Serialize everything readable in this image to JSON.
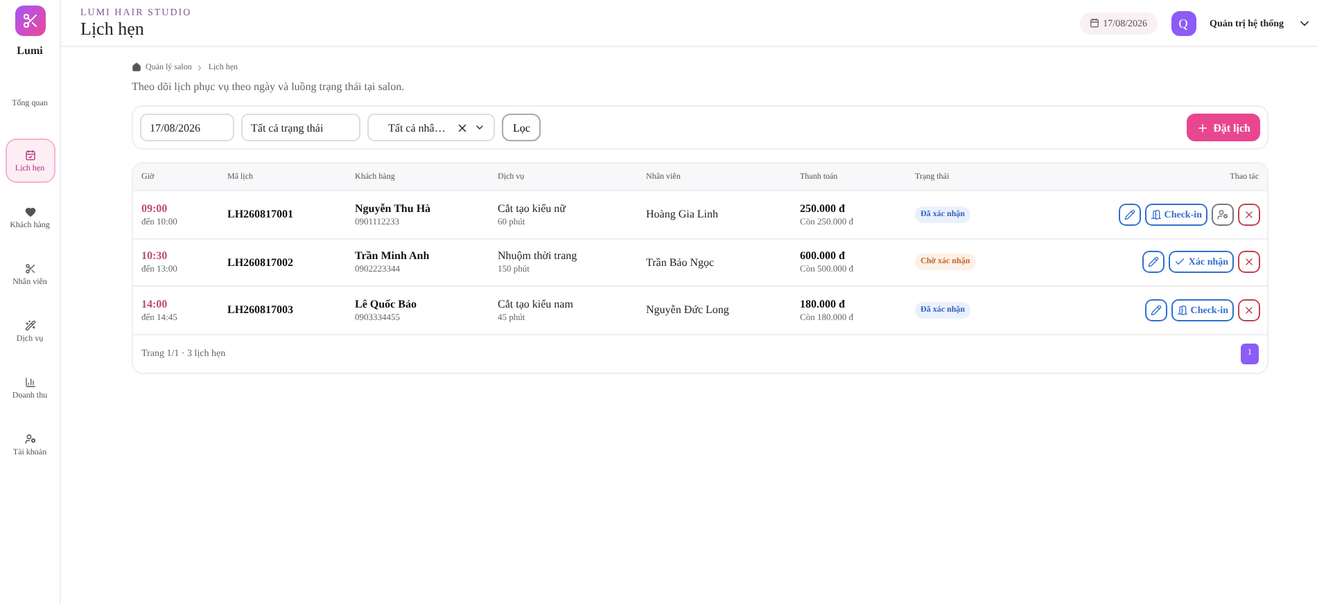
{
  "brand": {
    "name": "Lumi"
  },
  "nav": [
    {
      "label": "Tổng quan",
      "kind": "overview",
      "selected": false
    },
    {
      "label": "Lịch hẹn",
      "kind": "appointments",
      "selected": true
    },
    {
      "label": "Khách hàng",
      "kind": "customers",
      "selected": false
    },
    {
      "label": "Nhân viên",
      "kind": "staff",
      "selected": false
    },
    {
      "label": "Dịch vụ",
      "kind": "services",
      "selected": false
    },
    {
      "label": "Doanh thu",
      "kind": "revenue",
      "selected": false
    },
    {
      "label": "Tài khoản",
      "kind": "accounts",
      "selected": false
    }
  ],
  "header": {
    "studio": "LUMI HAIR STUDIO",
    "title": "Lịch hẹn",
    "date": "17/08/2026",
    "user": {
      "initial": "Q",
      "name": "Quản trị hệ thống"
    }
  },
  "breadcrumb": [
    "Quản lý salon",
    "Lịch hẹn"
  ],
  "description": "Theo dõi lịch phục vụ theo ngày và luồng trạng thái tại salon.",
  "filters": {
    "date": "17/08/2026",
    "status": "Tất cả trạng thái",
    "staff": "Tất cả nhâ…",
    "filter_button": "Lọc",
    "add_button": "Đặt lịch"
  },
  "table": {
    "columns": [
      "Giờ",
      "Mã lịch",
      "Khách hàng",
      "Dịch vụ",
      "Nhân viên",
      "Thanh toán",
      "Trạng thái",
      "Thao tác"
    ],
    "rows": [
      {
        "start": "09:00",
        "end": "đến 10:00",
        "code": "LH260817001",
        "customer": "Nguyễn Thu Hà",
        "phone": "0901112233",
        "service": "Cắt tạo kiểu nữ",
        "duration": "60 phút",
        "staff": "Hoàng Gia Linh",
        "amount": "250.000 đ",
        "remaining": "Còn 250.000 đ",
        "status": {
          "kind": "confirmed",
          "label": "Đã xác nhận"
        },
        "actions": [
          {
            "kind": "edit"
          },
          {
            "kind": "checkin",
            "label": "Check-in"
          },
          {
            "kind": "assign"
          },
          {
            "kind": "cancel"
          }
        ]
      },
      {
        "start": "10:30",
        "end": "đến 13:00",
        "code": "LH260817002",
        "customer": "Trần Minh Anh",
        "phone": "0902223344",
        "service": "Nhuộm thời trang",
        "duration": "150 phút",
        "staff": "Trần Bảo Ngọc",
        "amount": "600.000 đ",
        "remaining": "Còn 500.000 đ",
        "status": {
          "kind": "pending",
          "label": "Chờ xác nhận"
        },
        "actions": [
          {
            "kind": "edit"
          },
          {
            "kind": "confirm",
            "label": "Xác nhận"
          },
          {
            "kind": "cancel"
          }
        ]
      },
      {
        "start": "14:00",
        "end": "đến 14:45",
        "code": "LH260817003",
        "customer": "Lê Quốc Bảo",
        "phone": "0903334455",
        "service": "Cắt tạo kiểu nam",
        "duration": "45 phút",
        "staff": "Nguyễn Đức Long",
        "amount": "180.000 đ",
        "remaining": "Còn 180.000 đ",
        "status": {
          "kind": "confirmed",
          "label": "Đã xác nhận"
        },
        "actions": [
          {
            "kind": "edit"
          },
          {
            "kind": "checkin",
            "label": "Check-in"
          },
          {
            "kind": "cancel"
          }
        ]
      }
    ],
    "footer": "Trang 1/1 · 3 lịch hẹn",
    "pages": [
      {
        "label": "1",
        "selected": true
      }
    ]
  }
}
